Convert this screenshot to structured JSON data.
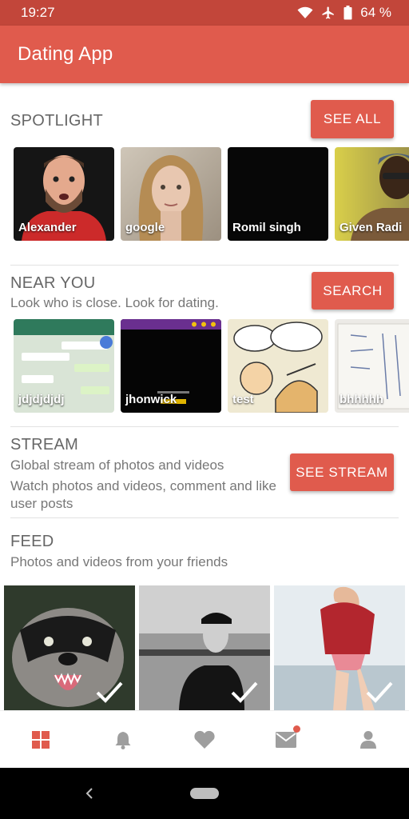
{
  "status_bar": {
    "time": "19:27",
    "battery": "64 %"
  },
  "app_bar": {
    "title": "Dating App"
  },
  "spotlight": {
    "title": "SPOTLIGHT",
    "button": "SEE ALL",
    "profiles": [
      {
        "name": "Alexander"
      },
      {
        "name": "google"
      },
      {
        "name": "Romil singh"
      },
      {
        "name": "Given Radi"
      }
    ]
  },
  "near_you": {
    "title": "NEAR YOU",
    "subtitle": "Look who is close. Look for dating.",
    "button": "SEARCH",
    "profiles": [
      {
        "name": "jdjdjdjdj"
      },
      {
        "name": "jhonwick"
      },
      {
        "name": "test"
      },
      {
        "name": "bhhhhh"
      }
    ]
  },
  "stream": {
    "title": "STREAM",
    "line1": "Global stream of photos and videos",
    "line2": "Watch photos and videos, comment and like user posts",
    "button": "SEE STREAM"
  },
  "feed": {
    "title": "FEED",
    "subtitle": "Photos and videos from your friends"
  },
  "bottom_nav": [
    {
      "icon": "grid-icon",
      "active": true
    },
    {
      "icon": "bell-icon"
    },
    {
      "icon": "heart-icon"
    },
    {
      "icon": "mail-icon",
      "badge": true
    },
    {
      "icon": "person-icon"
    }
  ],
  "colors": {
    "primary": "#e05b4d",
    "status": "#c2463a",
    "inactive_icon": "#9e9e9e"
  }
}
